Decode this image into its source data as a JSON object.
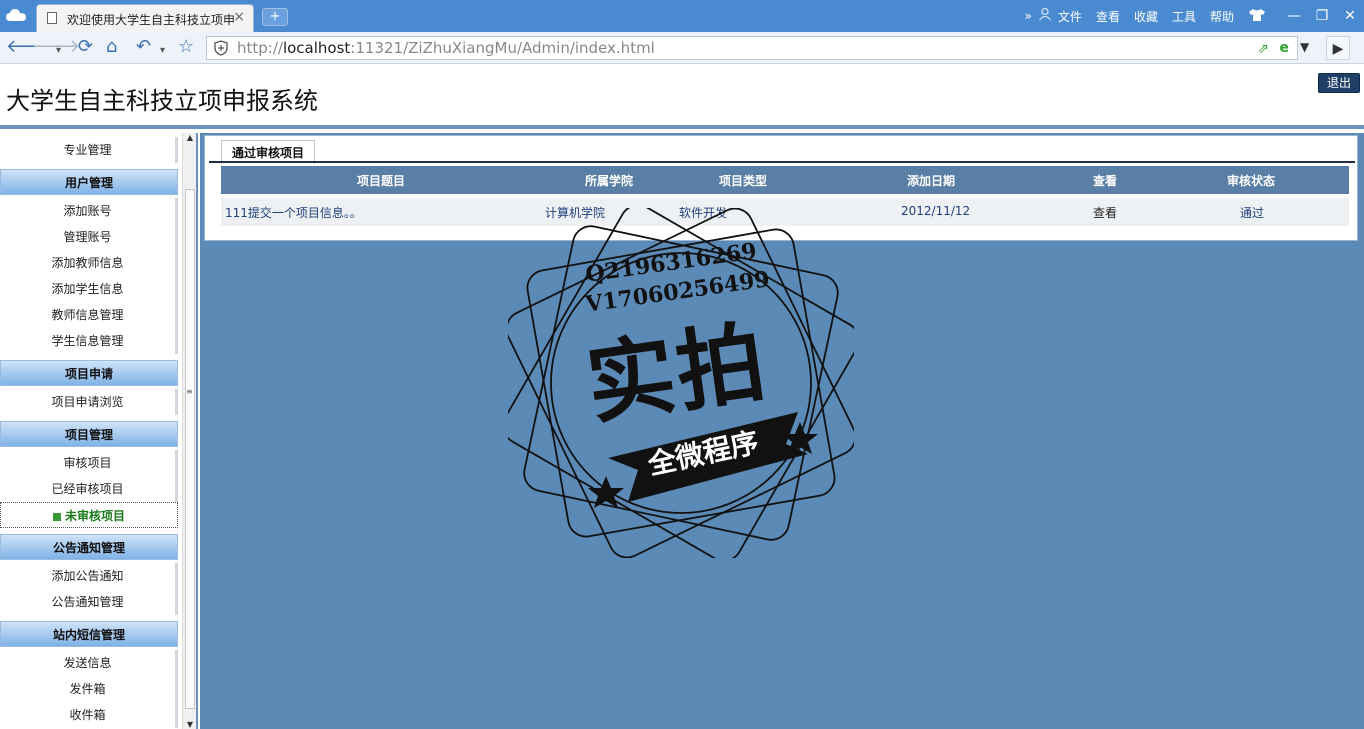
{
  "browser": {
    "tab_title": "欢迎使用大学生自主科技立项申",
    "tab_close": "×",
    "new_tab": "+",
    "menu": [
      "文件",
      "查看",
      "收藏",
      "工具",
      "帮助"
    ],
    "chevrons": "»",
    "window_controls": [
      "—",
      "❐",
      "✕"
    ],
    "url_prefix": "http://",
    "url_host": "localhost",
    "url_rest": ":11321/ZiZhuXiangMu/Admin/index.html",
    "accent": "#4a8ad0"
  },
  "header": {
    "title": "大学生自主科技立项申报系统",
    "logout_label": "退出"
  },
  "sidebar": {
    "items": [
      {
        "kind": "item",
        "label": "专业管理"
      },
      {
        "kind": "head",
        "label": "用户管理"
      },
      {
        "kind": "item",
        "label": "添加账号"
      },
      {
        "kind": "item",
        "label": "管理账号"
      },
      {
        "kind": "item",
        "label": "添加教师信息"
      },
      {
        "kind": "item",
        "label": "添加学生信息"
      },
      {
        "kind": "item",
        "label": "教师信息管理"
      },
      {
        "kind": "item",
        "label": "学生信息管理"
      },
      {
        "kind": "head",
        "label": "项目申请"
      },
      {
        "kind": "item",
        "label": "项目申请浏览"
      },
      {
        "kind": "head",
        "label": "项目管理"
      },
      {
        "kind": "item",
        "label": "审核项目"
      },
      {
        "kind": "item",
        "label": "已经审核项目"
      },
      {
        "kind": "active",
        "label": "未审核项目"
      },
      {
        "kind": "head",
        "label": "公告通知管理"
      },
      {
        "kind": "item",
        "label": "添加公告通知"
      },
      {
        "kind": "item",
        "label": "公告通知管理"
      },
      {
        "kind": "head",
        "label": "站内短信管理"
      },
      {
        "kind": "item",
        "label": "发送信息"
      },
      {
        "kind": "item",
        "label": "发件箱"
      },
      {
        "kind": "item",
        "label": "收件箱"
      }
    ]
  },
  "main": {
    "tab_label": "通过审核项目",
    "columns": [
      "项目题目",
      "所属学院",
      "项目类型",
      "添加日期",
      "查看",
      "审核状态"
    ],
    "rows": [
      {
        "title": "111提交一个项目信息。。",
        "college": "计算机学院",
        "type": "软件开发",
        "date": "2012/11/12",
        "view": "查看",
        "status": "通过"
      }
    ]
  },
  "watermark": {
    "line1": "Q2196316269",
    "line2": "V17060256499",
    "big": "实拍",
    "ribbon": "全微程序"
  }
}
